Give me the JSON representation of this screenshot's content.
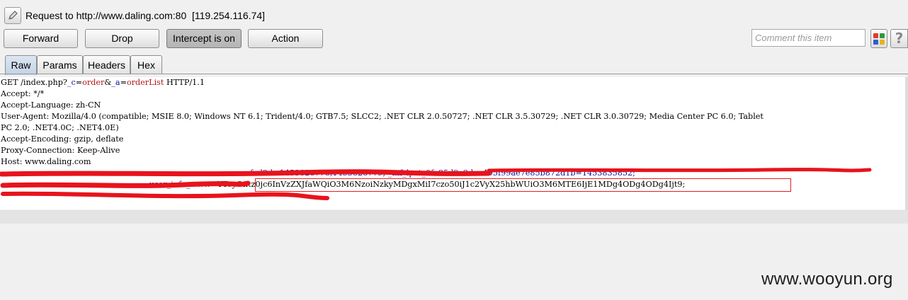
{
  "window": {
    "title": "Request to http://www.daling.com:80  [119.254.116.74]",
    "edit_icon": "pencil-icon"
  },
  "toolbar": {
    "forward_label": "Forward",
    "drop_label": "Drop",
    "intercept_label": "Intercept is on",
    "action_label": "Action",
    "comment_placeholder": "Comment this item",
    "highlight_icon": "color-grid-icon",
    "help_icon": "question-icon",
    "help_label": "?"
  },
  "tabs": [
    {
      "label": "Raw",
      "active": true
    },
    {
      "label": "Params",
      "active": false
    },
    {
      "label": "Headers",
      "active": false
    },
    {
      "label": "Hex",
      "active": false
    }
  ],
  "request": {
    "line1": {
      "pre": "GET /index.php?",
      "p1": "_c",
      "eq1": "=",
      "v1": "order",
      "amp": "&",
      "p2": "_a",
      "eq2": "=",
      "v2": "orderList",
      "post": " HTTP/1.1"
    },
    "headers": [
      "Accept: */*",
      "Accept-Language: zh-CN",
      "User-Agent: Mozilla/4.0 (compatible; MSIE 8.0; Windows NT 6.1; Trident/4.0; GTB7.5; SLCC2; .NET CLR 2.0.50727; .NET CLR 3.5.30729; .NET CLR 3.0.30729; Media Center PC 6.0; Tablet",
      "PC 2.0; .NET4.0C; .NET4.0E)",
      "Accept-Encoding: gzip, deflate",
      "Proxy-Connection: Keep-Alive",
      "Host: www.daling.com"
    ],
    "cookie_line1_tail": "fed2d=1453828778,1453828779; _mf_lpvt_0fa85d9e2dae495f99ae7e85b872d1b=1453835852;",
    "cookie_key": "user_info_www",
    "cookie_value": "=YToyOntz0jc6InVzZXJfaWQiO3M6NzoiNzkyMDgxMiI7czo50iJ1c2VyX25hbWUiO3M6MTE6IjE1MDg4ODg4ODg4Ijt9;"
  },
  "watermark": "www.wooyun.org",
  "colors": {
    "redaction": "#e8131c",
    "param_name": "#10109a",
    "param_value": "#b01818",
    "tab_active": "#c3d3e6"
  }
}
